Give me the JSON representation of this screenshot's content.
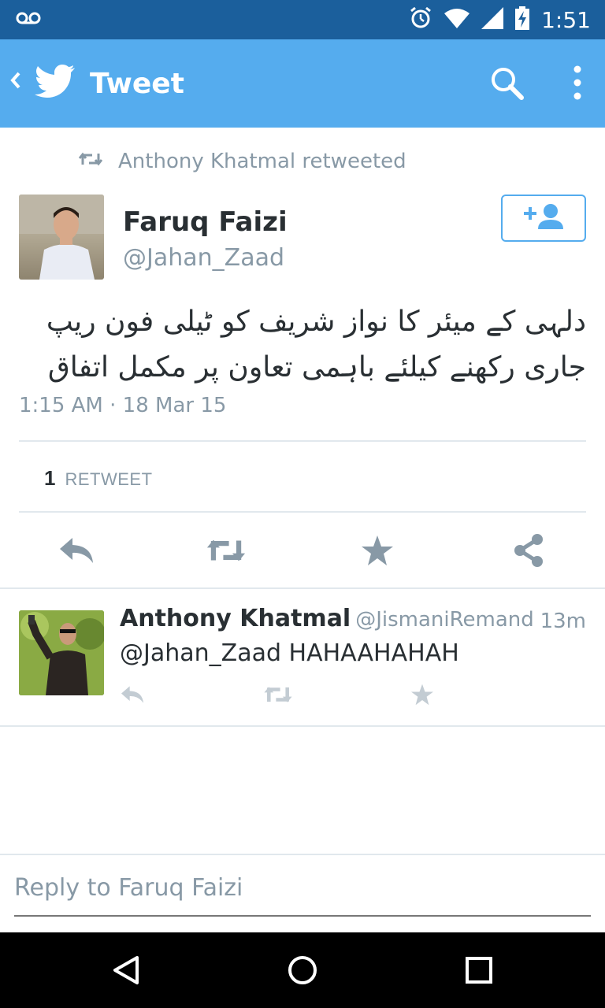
{
  "status_bar": {
    "time": "1:51",
    "icons": [
      "voicemail-icon",
      "alarm-icon",
      "wifi-icon",
      "signal-icon",
      "battery-charging-icon"
    ],
    "background": "#1b5f9c"
  },
  "toolbar": {
    "title": "Tweet",
    "background": "#55acee"
  },
  "retweet_context": {
    "text": "Anthony Khatmal retweeted"
  },
  "tweet": {
    "author_name": "Faruq Faizi",
    "author_handle": "@Jahan_Zaad",
    "text": "دلہی کے میئر کا نواز شریف کو ٹیلی فون ریپ جاری رکھنے کیلئے باہمی تعاون پر مکمل اتفاق",
    "timestamp": "1:15 AM · 18 Mar 15",
    "retweet_count": "1",
    "retweet_label": "RETWEET"
  },
  "reply": {
    "author_name": "Anthony Khatmal",
    "author_handle": "@JismaniRemand",
    "time": "13m",
    "text": "@Jahan_Zaad HAHAAHAHAH"
  },
  "compose": {
    "placeholder": "Reply to Faruq Faizi"
  },
  "colors": {
    "accent": "#55acee",
    "icon_gray": "#8899a6",
    "text_dark": "#292f33",
    "divider": "#e1e8ed"
  }
}
